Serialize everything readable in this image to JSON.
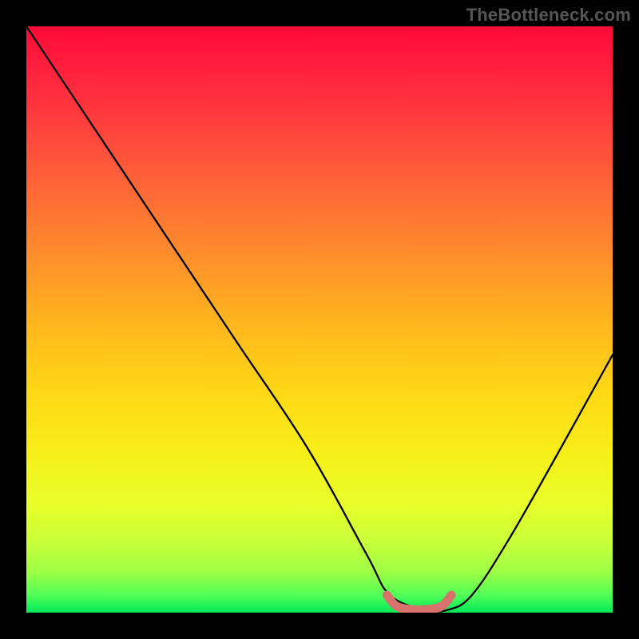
{
  "watermark": "TheBottleneck.com",
  "chart_data": {
    "type": "line",
    "title": "",
    "xlabel": "",
    "ylabel": "",
    "xlim": [
      0,
      100
    ],
    "ylim": [
      0,
      100
    ],
    "grid": false,
    "legend": false,
    "series": [
      {
        "name": "curve",
        "color": "#000000",
        "x": [
          0,
          12,
          24,
          36,
          48,
          58,
          62,
          68,
          72,
          76,
          82,
          90,
          100
        ],
        "y": [
          100,
          82,
          64,
          46,
          28,
          10,
          3,
          0.5,
          0.5,
          3,
          12,
          26,
          44
        ]
      },
      {
        "name": "flat-marker",
        "color": "#d8726c",
        "x": [
          61.5,
          63,
          65,
          67,
          69,
          71,
          72.5
        ],
        "y": [
          3.0,
          1.2,
          0.6,
          0.5,
          0.6,
          1.2,
          3.0
        ]
      }
    ],
    "annotations": []
  },
  "colors": {
    "background": "#000000",
    "gradient_top": "#ff0a3a",
    "gradient_bottom": "#00e85a",
    "curve": "#000000",
    "marker": "#d8726c",
    "watermark": "#565656"
  }
}
